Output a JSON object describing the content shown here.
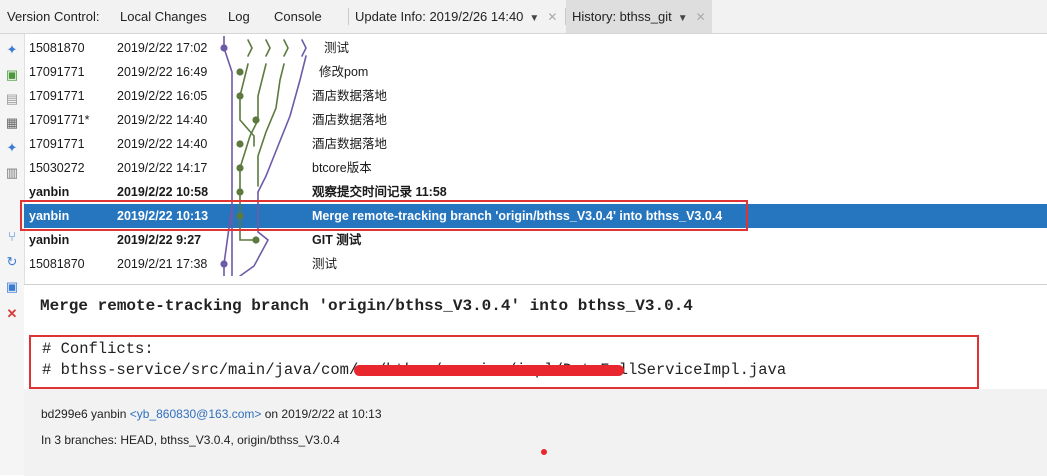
{
  "tabs": {
    "version_control": "Version Control:",
    "local_changes": "Local Changes",
    "log": "Log",
    "console": "Console",
    "update_info": "Update Info: 2019/2/26 14:40",
    "history": "History: bthss_git"
  },
  "commits": [
    {
      "author": "15081870",
      "date": "2019/2/22 17:02",
      "message": "测试",
      "bold": false,
      "selected": false
    },
    {
      "author": "17091771",
      "date": "2019/2/22 16:49",
      "message": "修改pom",
      "bold": false,
      "selected": false
    },
    {
      "author": "17091771",
      "date": "2019/2/22 16:05",
      "message": "酒店数据落地",
      "bold": false,
      "selected": false
    },
    {
      "author": "17091771*",
      "date": "2019/2/22 14:40",
      "message": "酒店数据落地",
      "bold": false,
      "selected": false
    },
    {
      "author": "17091771",
      "date": "2019/2/22 14:40",
      "message": "酒店数据落地",
      "bold": false,
      "selected": false
    },
    {
      "author": "15030272",
      "date": "2019/2/22 14:17",
      "message": "btcore版本",
      "bold": false,
      "selected": false
    },
    {
      "author": "yanbin",
      "date": "2019/2/22 10:58",
      "message": "观察提交时间记录 11:58",
      "bold": true,
      "selected": false
    },
    {
      "author": "yanbin",
      "date": "2019/2/22 10:13",
      "message": "Merge remote-tracking branch 'origin/bthss_V3.0.4' into bthss_V3.0.4",
      "bold": true,
      "selected": true
    },
    {
      "author": "yanbin",
      "date": "2019/2/22 9:27",
      "message": "GIT 测试",
      "bold": true,
      "selected": false
    },
    {
      "author": "15081870",
      "date": "2019/2/21 17:38",
      "message": "测试",
      "bold": false,
      "selected": false
    }
  ],
  "detail": {
    "subject": "Merge remote-tracking branch 'origin/bthss_V3.0.4' into bthss_V3.0.4",
    "conflicts_line": "# Conflicts:",
    "path_line": "# bthss-service/src/main/java/com/sn/bthss/service/impl/DataFallServiceImpl.java",
    "hash_author": "bd299e6 yanbin",
    "email": "<yb_860830@163.com>",
    "on_date": "on 2019/2/22 at 10:13",
    "branches": "In 3 branches: HEAD, bthss_V3.0.4, origin/bthss_V3.0.4"
  },
  "colors": {
    "selection": "#2675bf",
    "highlight_box": "#e03434",
    "graph_purple": "#6e5aa8",
    "graph_green": "#5c7a3e",
    "link": "#2f6fbd"
  },
  "icons": [
    "pin-icon",
    "add-icon",
    "paste-icon",
    "copy-icon",
    "merge-icon",
    "file-icon",
    "branch-icon",
    "refresh-icon",
    "terminal-icon",
    "close-icon"
  ]
}
